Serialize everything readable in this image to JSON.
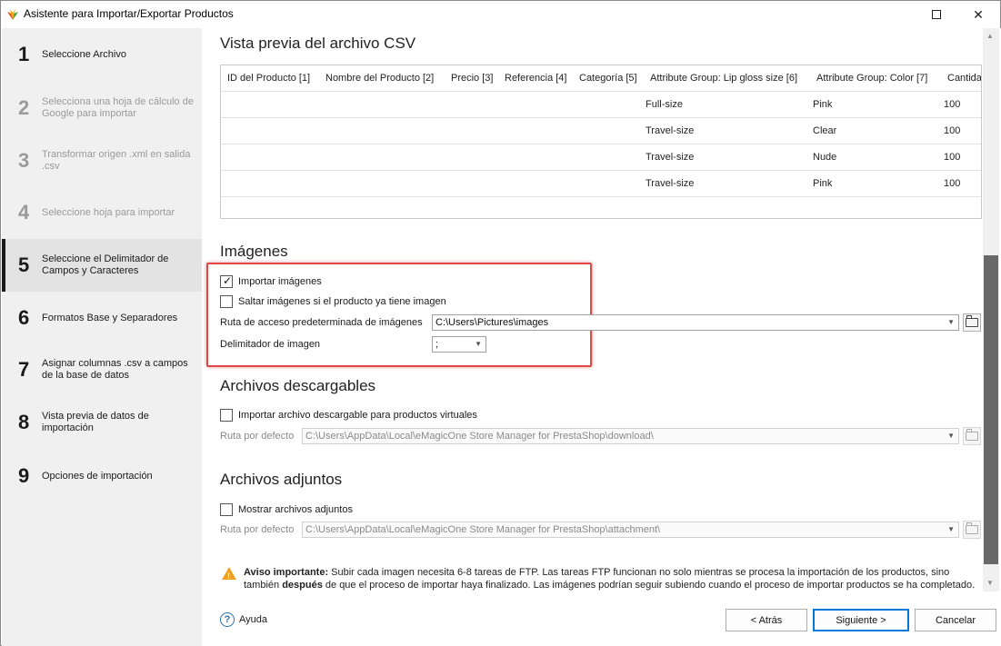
{
  "window": {
    "title": "Asistente para Importar/Exportar Productos",
    "maximize_icon": "maximize-icon",
    "close_symbol": "✕"
  },
  "sidebar": {
    "steps": [
      {
        "num": "1",
        "label": "Seleccione Archivo",
        "state": "normal"
      },
      {
        "num": "2",
        "label": "Selecciona una hoja de cálculo de Google para importar",
        "state": "dim"
      },
      {
        "num": "3",
        "label": "Transformar origen .xml en salida .csv",
        "state": "dim"
      },
      {
        "num": "4",
        "label": "Seleccione hoja para importar",
        "state": "dim"
      },
      {
        "num": "5",
        "label": "Seleccione el Delimitador de Campos y Caracteres",
        "state": "active"
      },
      {
        "num": "6",
        "label": "Formatos Base y Separadores",
        "state": "normal"
      },
      {
        "num": "7",
        "label": "Asignar columnas .csv a campos de la base de datos",
        "state": "normal"
      },
      {
        "num": "8",
        "label": "Vista previa de datos de importación",
        "state": "normal"
      },
      {
        "num": "9",
        "label": "Opciones de importación",
        "state": "normal"
      }
    ]
  },
  "csv_preview": {
    "title": "Vista previa del archivo CSV",
    "columns": [
      "ID del Producto [1]",
      "Nombre del Producto [2]",
      "Precio [3]",
      "Referencia [4]",
      "Categoría [5]",
      "Attribute Group: Lip gloss size [6]",
      "Attribute Group: Color [7]",
      "Cantida"
    ],
    "rows": [
      {
        "size": "Full-size",
        "color": "Pink",
        "qty": "100"
      },
      {
        "size": "Travel-size",
        "color": "Clear",
        "qty": "100"
      },
      {
        "size": "Travel-size",
        "color": "Nude",
        "qty": "100"
      },
      {
        "size": "Travel-size",
        "color": "Pink",
        "qty": "100"
      }
    ]
  },
  "images": {
    "title": "Imágenes",
    "import_label": "Importar imágenes",
    "import_checked": true,
    "skip_label": "Saltar imágenes si el producto ya tiene imagen",
    "skip_checked": false,
    "path_label": "Ruta de acceso predeterminada de imágenes",
    "path_value": "C:\\Users\\Pictures\\images",
    "delimiter_label": "Delimitador de imagen",
    "delimiter_value": ";"
  },
  "downloads": {
    "title": "Archivos descargables",
    "import_label": "Importar archivo descargable para productos virtuales",
    "import_checked": false,
    "path_label": "Ruta por defecto",
    "path_value": "C:\\Users\\AppData\\Local\\eMagicOne Store Manager for PrestaShop\\download\\"
  },
  "attachments": {
    "title": "Archivos adjuntos",
    "show_label": "Mostrar archivos adjuntos",
    "show_checked": false,
    "path_label": "Ruta por defecto",
    "path_value": "C:\\Users\\AppData\\Local\\eMagicOne Store Manager for PrestaShop\\attachment\\"
  },
  "notice": {
    "bold_prefix": "Aviso importante:",
    "text_1": " Subir cada imagen necesita 6-8 tareas de FTP. Las tareas FTP funcionan no solo mientras se procesa la importación de los productos, sino también ",
    "bold_mid": "después",
    "text_2": " de que el proceso de importar haya finalizado. Las imágenes podrían seguir subiendo cuando el proceso de importar productos se ha completado. Deberías"
  },
  "footer": {
    "help_symbol": "?",
    "help_label": "Ayuda",
    "back_label": "< Atrás",
    "next_label": "Siguiente >",
    "cancel_label": "Cancelar"
  },
  "colors": {
    "highlight": "#e04848",
    "accent": "#0078d7",
    "sidebar_bg": "#f0f0f0",
    "warning": "#f0a020"
  }
}
